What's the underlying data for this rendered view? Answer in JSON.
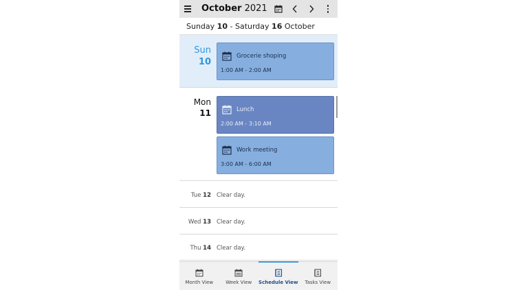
{
  "toolbar": {
    "month": "October",
    "year": "2021",
    "menu_icon": "hamburger-menu-icon",
    "calendar_icon": "calendar-icon",
    "prev_icon": "chevron-left-icon",
    "next_icon": "chevron-right-icon",
    "more_icon": "more-vertical-icon"
  },
  "range": {
    "start_day": "Sunday",
    "start_num": "10",
    "separator": "-",
    "end_day": "Saturday",
    "end_num": "16",
    "month": "October"
  },
  "days": [
    {
      "name": "Sun",
      "num": "10",
      "today": true,
      "events": [
        {
          "title": "Grocerie shoping",
          "time": "1:00 AM - 2:00 AM",
          "style": "light"
        }
      ]
    },
    {
      "name": "Mon",
      "num": "11",
      "events": [
        {
          "title": "Lunch",
          "time": "2:00 AM - 3:10 AM",
          "style": "dark"
        },
        {
          "title": "Work meeting",
          "time": "3:00 AM - 6:00 AM",
          "style": "light"
        }
      ]
    }
  ],
  "clear_days": [
    {
      "name": "Tue",
      "num": "12",
      "text": "Clear day."
    },
    {
      "name": "Wed",
      "num": "13",
      "text": "Clear day."
    },
    {
      "name": "Thu",
      "num": "14",
      "text": "Clear day."
    }
  ],
  "nav": {
    "tabs": [
      {
        "label": "Month View",
        "icon": "month-view-icon"
      },
      {
        "label": "Week View",
        "icon": "week-view-icon"
      },
      {
        "label": "Schedule View",
        "icon": "schedule-view-icon",
        "active": true
      },
      {
        "label": "Tasks View",
        "icon": "tasks-view-icon"
      }
    ]
  },
  "colors": {
    "accent": "#2f96dc",
    "event_light": "#86afe0",
    "event_dark": "#6a86c2",
    "today_bg": "#e1eef9"
  }
}
